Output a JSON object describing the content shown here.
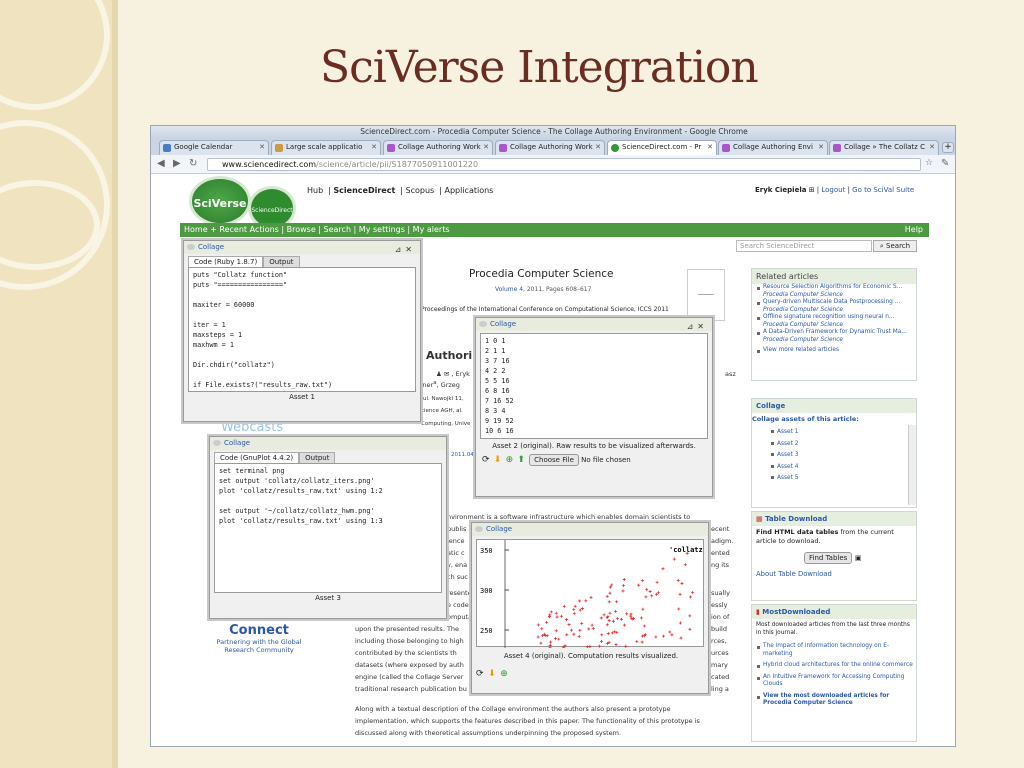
{
  "slide": {
    "title": "SciVerse Integration"
  },
  "browser": {
    "window_title": "ScienceDirect.com - Procedia Computer Science - The Collage Authoring Environment - Google Chrome",
    "tabs": [
      {
        "label": "Google Calendar",
        "active": false
      },
      {
        "label": "Large scale applicatio",
        "active": false
      },
      {
        "label": "Collage Authoring Work",
        "active": false
      },
      {
        "label": "Collage Authoring Work",
        "active": false
      },
      {
        "label": "ScienceDirect.com - Pr",
        "active": true
      },
      {
        "label": "Collage Authoring Envi",
        "active": false
      },
      {
        "label": "Collage » The Collatz C",
        "active": false
      }
    ],
    "url_host": "www.sciencedirect.com",
    "url_path": "/science/article/pii/S1877050911001220"
  },
  "sd": {
    "logo": "SciVerse",
    "logo_sub": "ScienceDirect",
    "nav": [
      "Hub",
      "ScienceDirect",
      "Scopus",
      "Applications"
    ],
    "user": "Eryk Ciepiela",
    "logout": "Logout",
    "scival": "Go to SciVal Suite",
    "greenbar": [
      "Home + Recent Actions",
      "Browse",
      "Search",
      "My settings",
      "My alerts"
    ],
    "help": "Help",
    "search_placeholder": "Search ScienceDirect",
    "search_button": "Search",
    "journal": "Procedia Computer Science",
    "volume_link": "Volume 4",
    "volume_rest": ", 2011, Pages 608–617",
    "conference": "Proceedings of the International Conference on Computational Science, ICCS 2011",
    "heading_frag": "Authorin",
    "author_frag": "Eryk",
    "author_frag2": "zner",
    "author_frag3": ", Grzeg",
    "asz": "asz",
    "addr1": "ul. Nawojki 11,",
    "addr2": "cience AGH, al.",
    "addr3": "Computing, Unive",
    "date_frag": "2011.04",
    "webcasts": "Webcasts",
    "connect_title": "Connect",
    "connect_sub": "Partnering with the Global Research Community",
    "body_lines": [
      "nvironment is a software infrastructure which enables domain scientists to",
      "publis",
      "ience",
      "atic c",
      "y, ena",
      "ch suc",
      "resentec",
      "e code",
      "omputa",
      "upon the presented results. The",
      "including those belonging to high",
      "contributed by the scientists th",
      "datasets (where exposed by auth",
      "engine (called the Collage Server",
      "traditional research publication bu",
      "Along with a textual description of the Collage environment the authors also present a prototype",
      "implementation, which supports the features described in this paper. The functionality of this prototype is",
      "discussed along with theoretical assumptions underpinning the proposed system."
    ],
    "body_right": [
      "ecent",
      "adigm.",
      "ented",
      "ng its",
      "sually",
      "essly",
      "ion of",
      "build",
      "rces,",
      "urces",
      "mary",
      "cated",
      "ling a"
    ]
  },
  "related": {
    "title": "Related articles",
    "items": [
      {
        "t": "Resource Selection Algorithms for Economic S...",
        "j": "Procedia Computer Science"
      },
      {
        "t": "Query-driven Multiscale Data Postprocessing ...",
        "j": "Procedia Computer Science"
      },
      {
        "t": "Offline signature recognition using neural n...",
        "j": "Procedia Computer Science"
      },
      {
        "t": "A Data-Driven Framework for Dynamic Trust Ma...",
        "j": "Procedia Computer Science"
      }
    ],
    "more": "View more related articles"
  },
  "collage_side": {
    "title": "Collage",
    "subtitle": "Collage assets of this article:",
    "assets": [
      "Asset 1",
      "Asset 2",
      "Asset 3",
      "Asset 4",
      "Asset 5"
    ]
  },
  "table_download": {
    "title": "Table Download",
    "find": "Find HTML data tables",
    "find_rest": " from the current article to download.",
    "button": "Find Tables",
    "about": "About Table Download"
  },
  "most_downloaded": {
    "title": "MostDownloaded",
    "desc": "Most downloaded articles from the last three months in this journal.",
    "items": [
      "The impact of information technology on E-marketing",
      "Hybrid cloud architectures for the online commerce",
      "An Intuitive Framework for Accessing Computing Clouds"
    ],
    "view": "View the most downloaded articles for Procedia Computer Science"
  },
  "win_ruby": {
    "title": "Collage",
    "tab_code": "Code (Ruby 1.8.7)",
    "tab_output": "Output",
    "code": "puts \"Collatz function\"\nputs \"================\"\n\nmaxiter = 60000\n\niter = 1\nmaxsteps = 1\nmaxhwm = 1\n\nDir.chdir(\"collatz\")\n\nif File.exists?(\"results_raw.txt\")\n  File.delete(\"results_raw.txt\")",
    "caption": "Asset 1"
  },
  "win_gnuplot": {
    "title": "Collage",
    "tab_code": "Code (GnuPlot 4.4.2)",
    "tab_output": "Output",
    "code": "set terminal png\nset output 'collatz/collatz_iters.png'\nplot 'collatz/results_raw.txt' using 1:2\n\nset output '~/collatz/collatz_hwm.png'\nplot 'collatz/results_raw.txt' using 1:3",
    "caption": "Asset 3"
  },
  "win_output": {
    "title": "Collage",
    "data": "1 0 1\n2 1 1\n3 7 16\n4 2 2\n5 5 16\n6 8 16\n7 16 52\n8 3 4\n9 19 52\n10 6 16",
    "caption": "Asset 2 (original). Raw results to be visualized afterwards.",
    "choose": "Choose File",
    "nofile": "No file chosen"
  },
  "win_plot": {
    "title": "Collage",
    "yticks": [
      "350",
      "300",
      "250"
    ],
    "legend": "'collatz",
    "caption": "Asset 4 (original). Computation results visualized."
  }
}
